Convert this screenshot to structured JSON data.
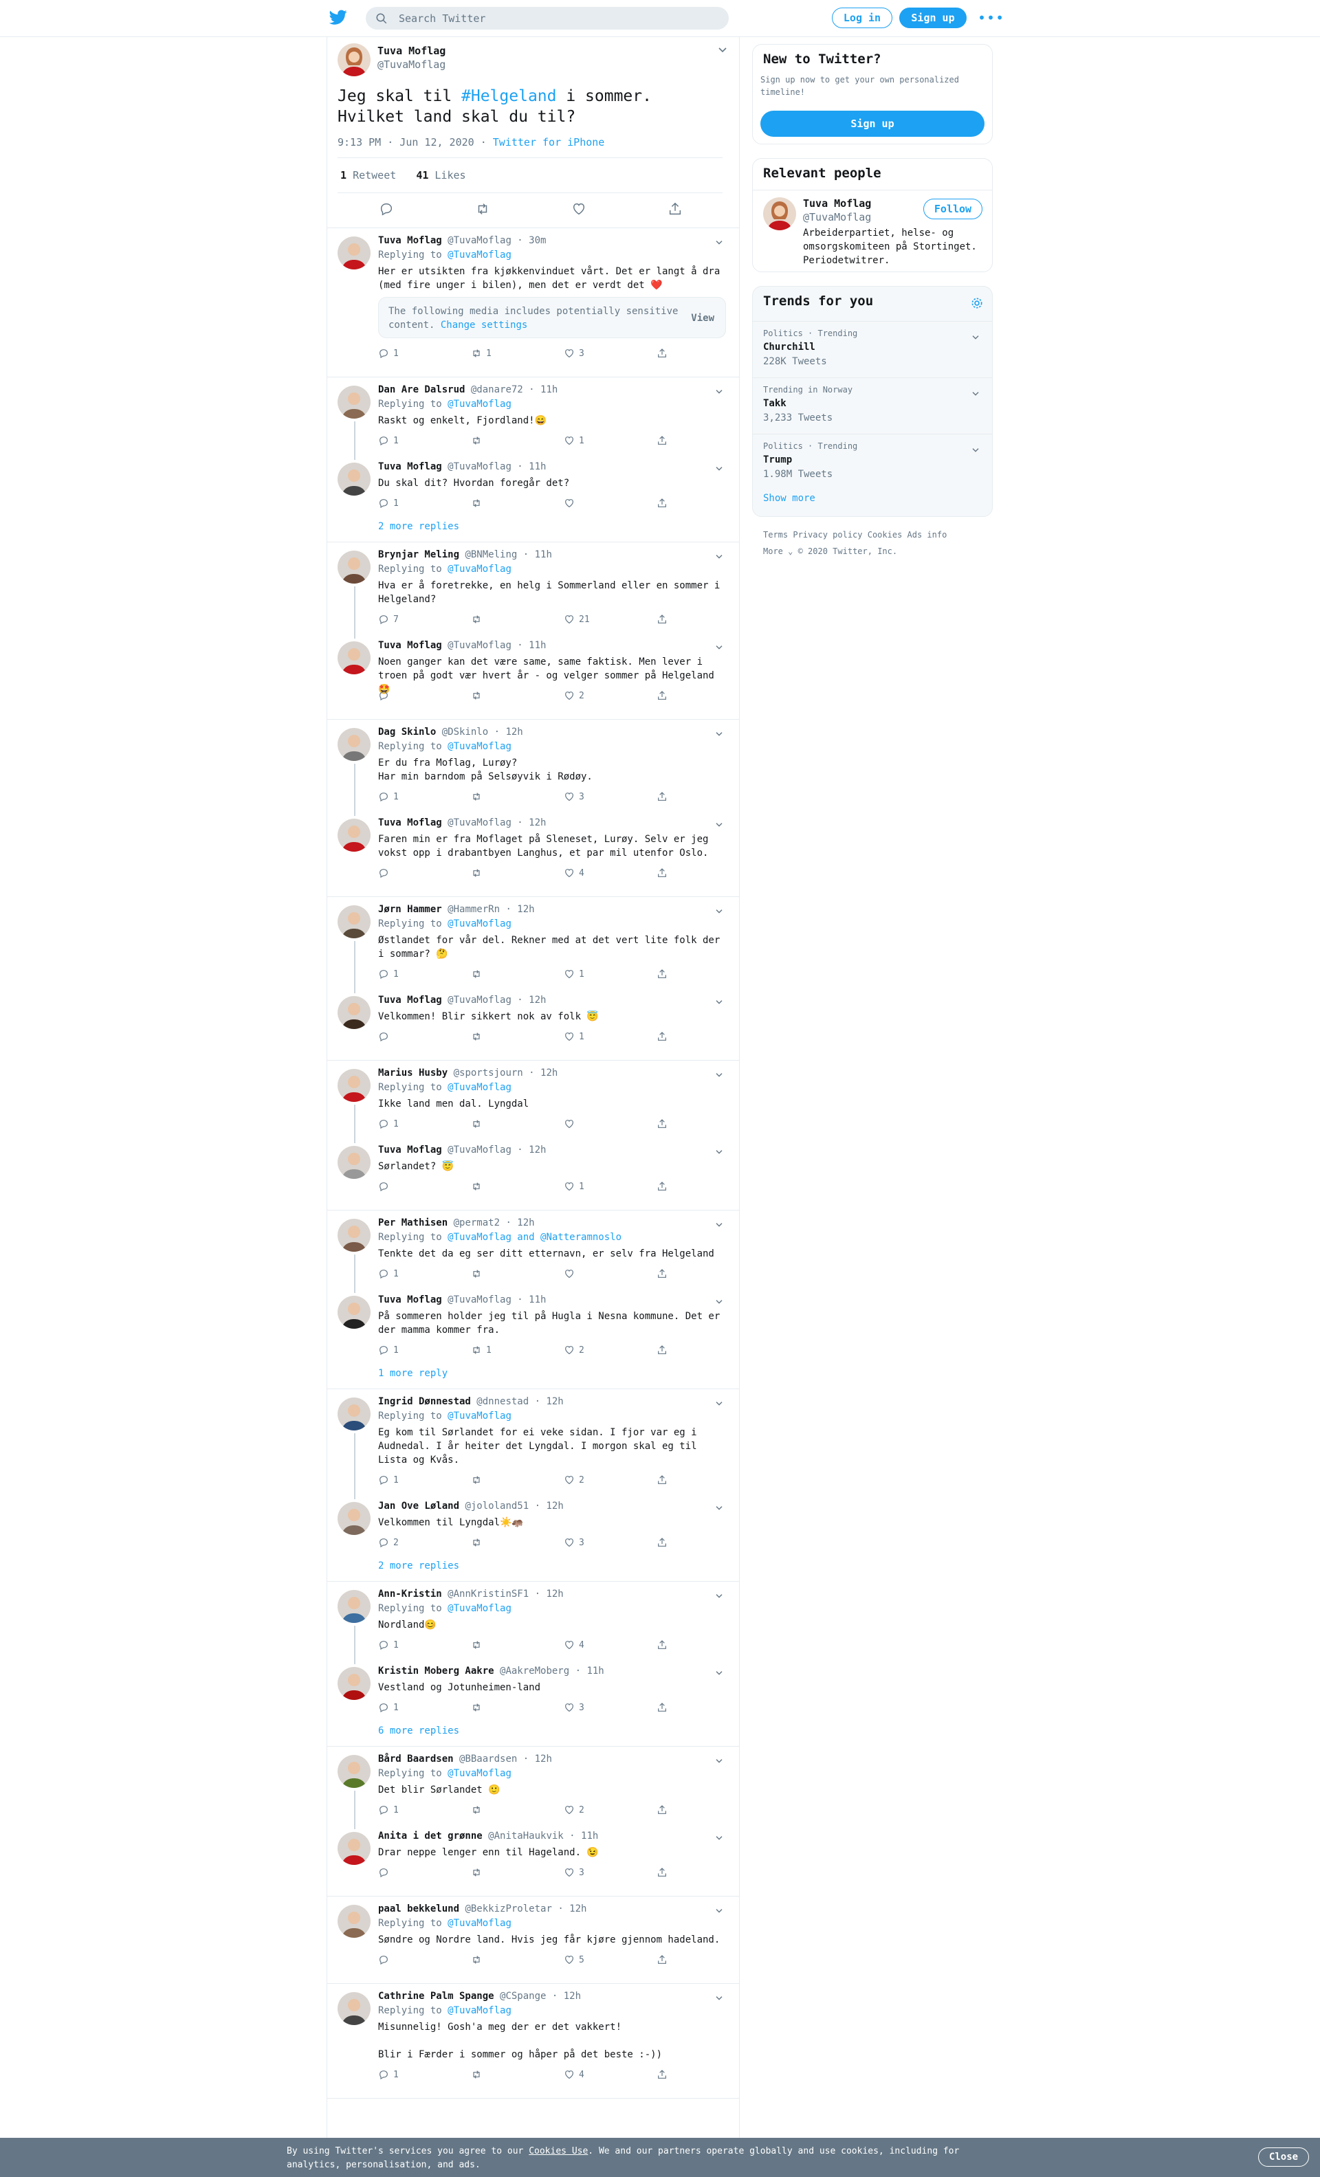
{
  "header": {
    "search_placeholder": "Search Twitter",
    "login_label": "Log in",
    "signup_label": "Sign up",
    "more_label": "•••"
  },
  "main_tweet": {
    "name": "Tuva Moflag",
    "handle": "@TuvaMoflag",
    "text_before": "Jeg skal til ",
    "hashtag": "#Helgeland",
    "text_after": " i sommer. Hvilket land skal du til?",
    "time": "9:13 PM · Jun 12, 2020 · ",
    "source": "Twitter for iPhone",
    "retweets_count": "1",
    "retweets_label": "Retweet",
    "likes_count": "41",
    "likes_label": "Likes"
  },
  "threads": [
    {
      "replies": [
        {
          "name": "Tuva Moflag",
          "handle": "@TuvaMoflag · 30m",
          "replying": "@TuvaMoflag",
          "text": "Her er utsikten fra kjøkkenvinduet vårt. Det er langt å dra (med fire unger i bilen), men det er verdt det ❤️",
          "reply": "1",
          "rt": "1",
          "like": "3",
          "sensitive": {
            "text": "The following media includes potentially sensitive content.",
            "link": "Change settings",
            "view": "View"
          }
        }
      ]
    },
    {
      "replies": [
        {
          "name": "Dan Are Dalsrud",
          "handle": "@danare72 · 11h",
          "replying": "@TuvaMoflag",
          "text": "Raskt og enkelt, Fjordland!😄",
          "reply": "1",
          "rt": "",
          "like": "1"
        },
        {
          "name": "Tuva Moflag",
          "handle": "@TuvaMoflag · 11h",
          "text": "Du skal dit? Hvordan foregår det?",
          "reply": "1",
          "rt": "",
          "like": ""
        }
      ],
      "more": "2 more replies"
    },
    {
      "replies": [
        {
          "name": "Brynjar Meling",
          "handle": "@BNMeling · 11h",
          "replying": "@TuvaMoflag",
          "text": "Hva er å foretrekke, en helg i Sommerland eller en sommer i Helgeland?",
          "reply": "7",
          "rt": "",
          "like": "21"
        },
        {
          "name": "Tuva Moflag",
          "handle": "@TuvaMoflag · 11h",
          "text": "Noen ganger kan det være same, same faktisk. Men lever i troen på godt vær hvert år - og velger sommer på Helgeland 🤩",
          "reply": "",
          "rt": "",
          "like": "2"
        }
      ]
    },
    {
      "replies": [
        {
          "name": "Dag Skinlo",
          "handle": "@DSkinlo · 12h",
          "replying": "@TuvaMoflag",
          "text": "Er du fra Moflag, Lurøy?\nHar min barndom på Selsøyvik i Rødøy.",
          "reply": "1",
          "rt": "",
          "like": "3"
        },
        {
          "name": "Tuva Moflag",
          "handle": "@TuvaMoflag · 12h",
          "text": "Faren min er fra Moflaget på Sleneset, Lurøy. Selv er jeg vokst opp i drabantbyen Langhus, et par mil utenfor Oslo.",
          "reply": "",
          "rt": "",
          "like": "4"
        }
      ]
    },
    {
      "replies": [
        {
          "name": "Jørn Hammer",
          "handle": "@HammerRn · 12h",
          "replying": "@TuvaMoflag",
          "text": "Østlandet for vår del. Rekner med at det vert lite folk der i sommar? 🤔",
          "reply": "1",
          "rt": "",
          "like": "1"
        },
        {
          "name": "Tuva Moflag",
          "handle": "@TuvaMoflag · 12h",
          "text": "Velkommen! Blir sikkert nok av folk 😇",
          "reply": "",
          "rt": "",
          "like": "1"
        }
      ]
    },
    {
      "replies": [
        {
          "name": "Marius Husby",
          "handle": "@sportsjourn · 12h",
          "replying": "@TuvaMoflag",
          "text": "Ikke land men dal. Lyngdal",
          "reply": "1",
          "rt": "",
          "like": ""
        },
        {
          "name": "Tuva Moflag",
          "handle": "@TuvaMoflag · 12h",
          "text": "Sørlandet? 😇",
          "reply": "",
          "rt": "",
          "like": "1"
        }
      ]
    },
    {
      "replies": [
        {
          "name": "Per Mathisen",
          "handle": "@permat2 · 12h",
          "replying": "@TuvaMoflag and @Natteramnoslo",
          "text": "Tenkte det da eg ser ditt etternavn, er selv fra Helgeland",
          "reply": "1",
          "rt": "",
          "like": ""
        },
        {
          "name": "Tuva Moflag",
          "handle": "@TuvaMoflag · 11h",
          "text": "På sommeren holder jeg til på Hugla i Nesna kommune. Det er der mamma kommer fra.",
          "reply": "1",
          "rt": "1",
          "like": "2"
        }
      ],
      "more": "1 more reply"
    },
    {
      "replies": [
        {
          "name": "Ingrid Dønnestad",
          "handle": "@dnnestad · 12h",
          "replying": "@TuvaMoflag",
          "text": "Eg kom til Sørlandet for ei veke sidan. I fjor var eg i Audnedal. I år heiter det Lyngdal. I morgon skal eg til Lista og Kvås.",
          "reply": "1",
          "rt": "",
          "like": "2"
        },
        {
          "name": "Jan Ove Løland",
          "handle": "@jololand51 · 12h",
          "text": "Velkommen til Lyngdal☀️🦛",
          "reply": "2",
          "rt": "",
          "like": "3"
        }
      ],
      "more": "2 more replies"
    },
    {
      "replies": [
        {
          "name": "Ann-Kristin",
          "handle": "@AnnKristinSF1 · 12h",
          "replying": "@TuvaMoflag",
          "text": "Nordland😊",
          "reply": "1",
          "rt": "",
          "like": "4"
        },
        {
          "name": "Kristin Moberg Aakre",
          "handle": "@AakreMoberg · 11h",
          "text": "Vestland og Jotunheimen-land",
          "reply": "1",
          "rt": "",
          "like": "3"
        }
      ],
      "more": "6 more replies"
    },
    {
      "replies": [
        {
          "name": "Bård Baardsen",
          "handle": "@BBaardsen · 12h",
          "replying": "@TuvaMoflag",
          "text": "Det blir Sørlandet 🙂",
          "reply": "1",
          "rt": "",
          "like": "2"
        },
        {
          "name": "Anita i det grønne",
          "handle": "@AnitaHaukvik · 11h",
          "text": "Drar neppe lenger enn til Hageland. 😉",
          "reply": "",
          "rt": "",
          "like": "3"
        }
      ]
    },
    {
      "replies": [
        {
          "name": "paal bekkelund",
          "handle": "@BekkizProletar · 12h",
          "replying": "@TuvaMoflag",
          "text": "Søndre og Nordre land. Hvis jeg får kjøre gjennom hadeland.",
          "reply": "",
          "rt": "",
          "like": "5"
        }
      ]
    },
    {
      "replies": [
        {
          "name": "Cathrine Palm Spange",
          "handle": "@CSpange · 12h",
          "replying": "@TuvaMoflag",
          "text": "Misunnelig! Gosh'a meg der er det vakkert!\n\nBlir i Færder i sommer og håper på det beste :-))",
          "reply": "1",
          "rt": "",
          "like": "4"
        }
      ]
    }
  ],
  "sidebar": {
    "new_title": "New to Twitter?",
    "new_sub": "Sign up now to get your own personalized timeline!",
    "signup_label": "Sign up",
    "relevant_title": "Relevant people",
    "person_name": "Tuva Moflag",
    "person_handle": "@TuvaMoflag",
    "follow_label": "Follow",
    "person_bio": "Arbeiderpartiet, helse- og omsorgskomiteen på Stortinget. Periodetwitrer.",
    "trends_title": "Trends for you",
    "trends": [
      {
        "context": "Politics · Trending",
        "topic": "Churchill",
        "count": "228K Tweets"
      },
      {
        "context": "Trending in Norway",
        "topic": "Takk",
        "count": "3,233 Tweets"
      },
      {
        "context": "Politics · Trending",
        "topic": "Trump",
        "count": "1.98M Tweets"
      }
    ],
    "show_more": "Show more",
    "footer_line1": "Terms  Privacy policy  Cookies  Ads info",
    "footer_more": "More",
    "footer_copy": "© 2020 Twitter, Inc."
  },
  "cookie_bar": {
    "text_before": "By using Twitter's services you agree to our ",
    "link": "Cookies Use",
    "text_after": ". We and our partners operate globally and use cookies, including for analytics, personalisation, and ads.",
    "close_label": "Close"
  },
  "colors": {
    "accent": "#1da1f2",
    "muted": "#657786",
    "border": "#e6ecf0",
    "cookie_bg": "#657786"
  }
}
